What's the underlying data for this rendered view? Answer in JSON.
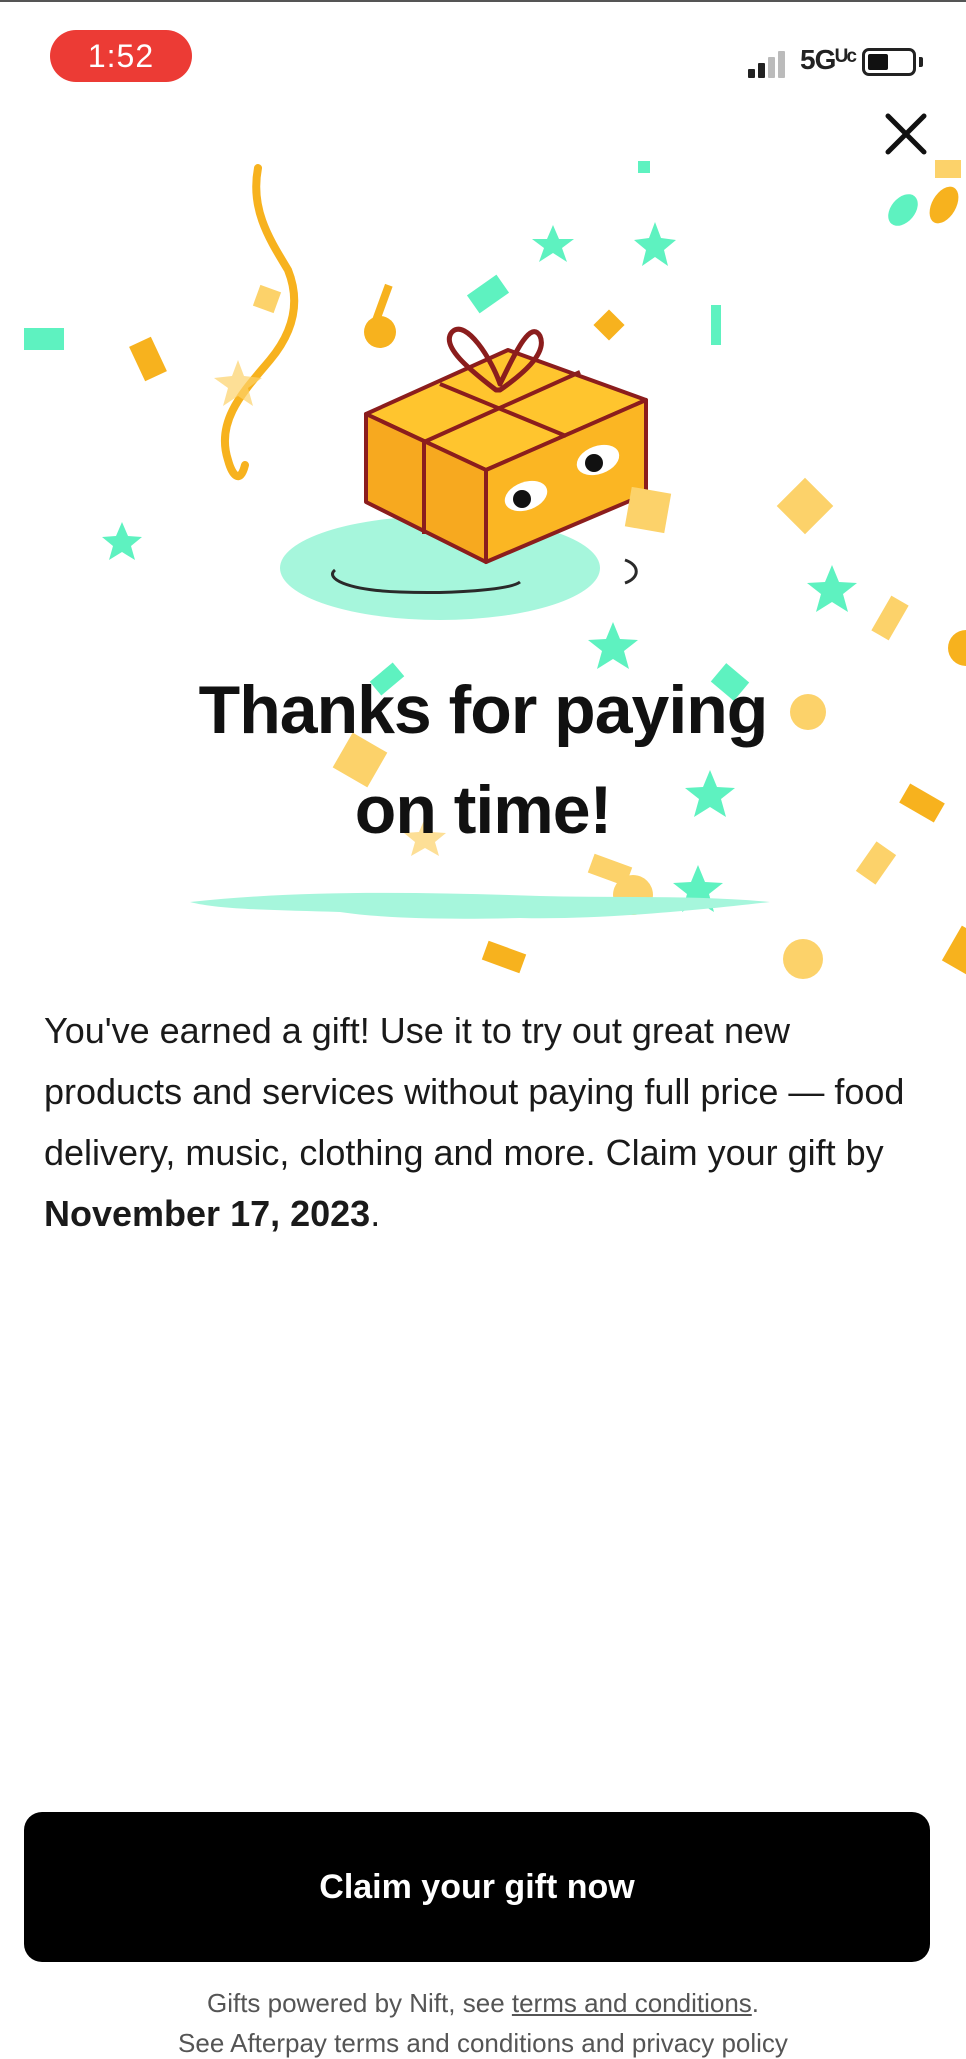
{
  "status_bar": {
    "time": "1:52",
    "network": "5Gᵁᶜ"
  },
  "close": {
    "icon": "close-icon"
  },
  "title": {
    "line1": "Thanks for paying",
    "line2": "on time!"
  },
  "body": {
    "text": "You've earned a gift! Use it to try out great new products and services without paying full price — food delivery, music, clothing and more. Claim your gift by ",
    "date": "November 17, 2023",
    "end": "."
  },
  "claim_button": {
    "label": "Claim your gift now"
  },
  "footer": {
    "line1_prefix": "Gifts powered by Nift, see ",
    "line1_link": "terms and conditions",
    "line1_suffix": ".",
    "line2": "See Afterpay terms and conditions and privacy policy"
  },
  "colors": {
    "accent_mint": "#5ef2c0",
    "accent_orange": "#f7b21e",
    "button": "#000000",
    "time_pill": "#ec3b35"
  }
}
